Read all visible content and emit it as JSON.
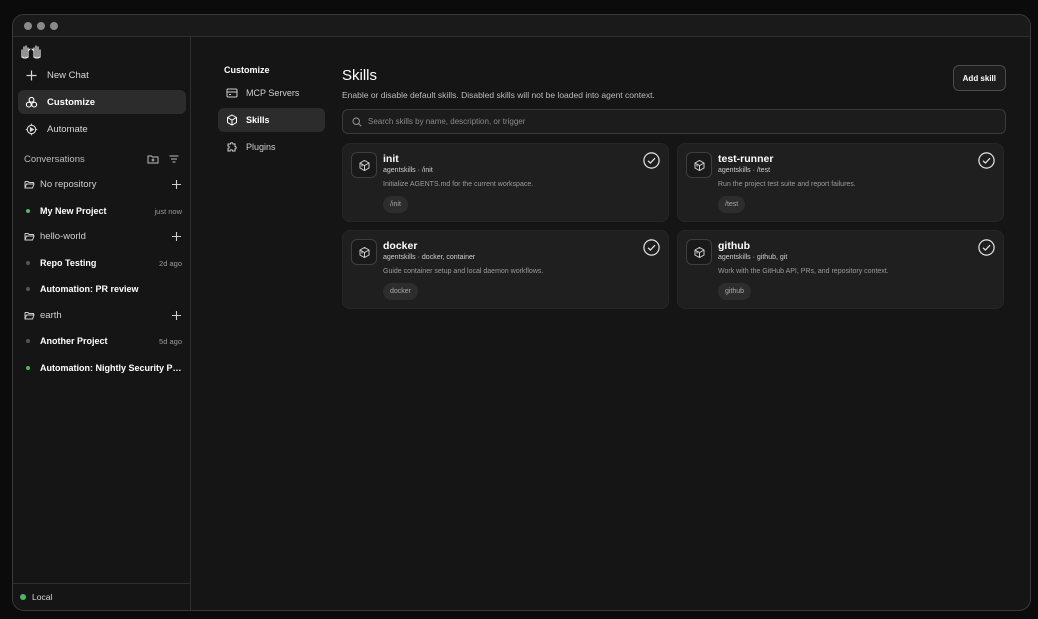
{
  "sidebar": {
    "nav": [
      {
        "label": "New Chat",
        "icon": "plus-icon"
      },
      {
        "label": "Customize",
        "icon": "customize-icon",
        "active": true
      },
      {
        "label": "Automate",
        "icon": "automate-icon"
      }
    ],
    "conversations_label": "Conversations",
    "groups": [
      {
        "name": "No repository",
        "threads": [
          {
            "title": "My New Project",
            "time": "just now",
            "status": "active"
          }
        ]
      },
      {
        "name": "hello-world",
        "threads": [
          {
            "title": "Repo Testing",
            "time": "2d ago",
            "status": "idle"
          },
          {
            "title": "Automation: PR review",
            "time": "",
            "status": "idle"
          }
        ]
      },
      {
        "name": "earth",
        "threads": [
          {
            "title": "Another Project",
            "time": "5d ago",
            "status": "idle"
          },
          {
            "title": "Automation: Nightly Security Pa...",
            "time": "",
            "status": "active"
          }
        ]
      }
    ],
    "footer_label": "Local"
  },
  "subnav": {
    "title": "Customize",
    "items": [
      {
        "label": "MCP Servers",
        "icon": "server-icon"
      },
      {
        "label": "Skills",
        "icon": "cube-icon",
        "active": true
      },
      {
        "label": "Plugins",
        "icon": "puzzle-icon"
      }
    ]
  },
  "main": {
    "title": "Skills",
    "subtitle": "Enable or disable default skills. Disabled skills will not be loaded into agent context.",
    "add_button": "Add skill",
    "search_placeholder": "Search skills by name, description, or trigger",
    "skills": [
      {
        "name": "init",
        "meta": "agentskills · /init",
        "description": "Initialize AGENTS.md for the current workspace.",
        "tag": "/init",
        "enabled": true
      },
      {
        "name": "test-runner",
        "meta": "agentskills · /test",
        "description": "Run the project test suite and report failures.",
        "tag": "/test",
        "enabled": true
      },
      {
        "name": "docker",
        "meta": "agentskills · docker, container",
        "description": "Guide container setup and local daemon workflows.",
        "tag": "docker",
        "enabled": true
      },
      {
        "name": "github",
        "meta": "agentskills · github, git",
        "description": "Work with the GitHub API, PRs, and repository context.",
        "tag": "github",
        "enabled": true
      }
    ]
  },
  "colors": {
    "accent_green": "#3fbf5f",
    "background": "#151515",
    "card": "#1f1f1f"
  }
}
